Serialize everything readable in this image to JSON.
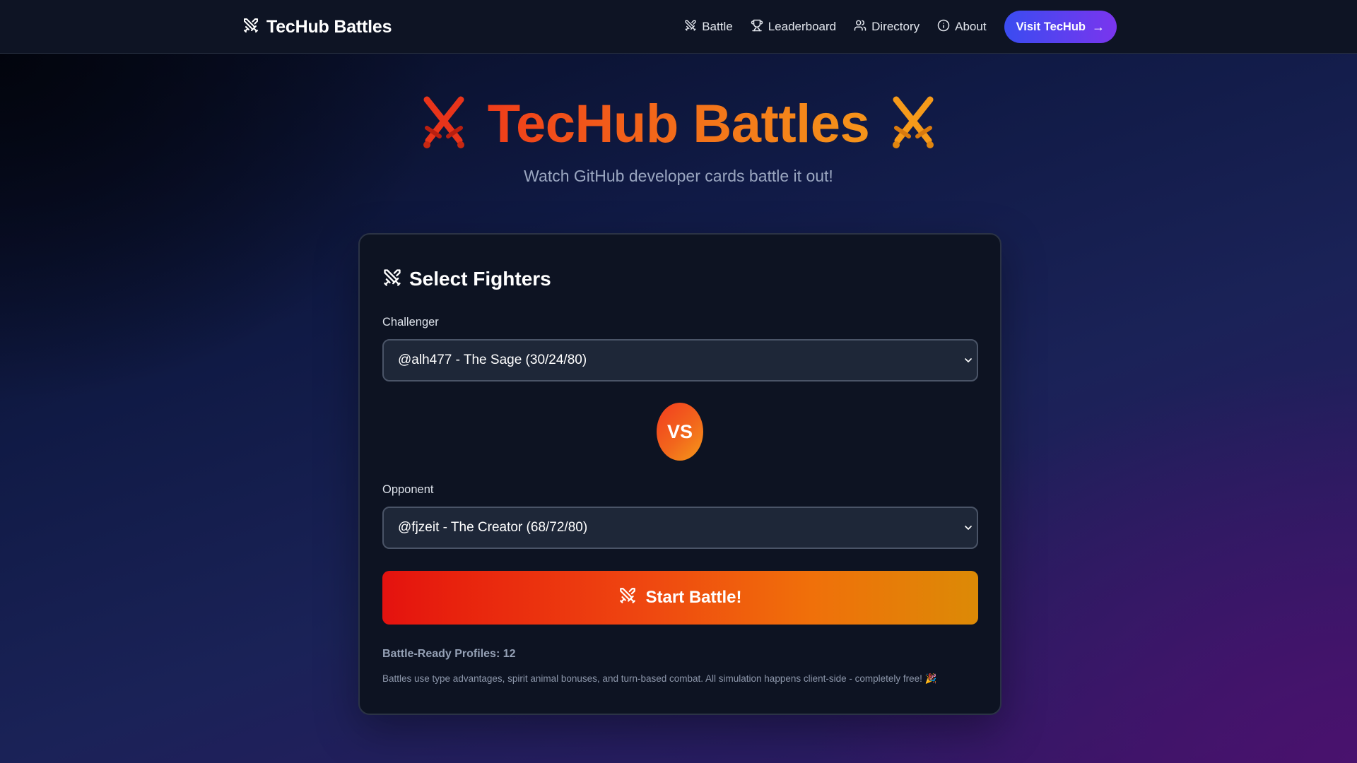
{
  "nav": {
    "brand": "TecHub Battles",
    "links": [
      {
        "label": "Battle",
        "icon": "swords-icon"
      },
      {
        "label": "Leaderboard",
        "icon": "trophy-icon"
      },
      {
        "label": "Directory",
        "icon": "users-icon"
      },
      {
        "label": "About",
        "icon": "info-icon"
      }
    ],
    "cta": {
      "label": "Visit TecHub",
      "arrow": "→"
    }
  },
  "hero": {
    "title": "TecHub Battles",
    "subtitle": "Watch GitHub developer cards battle it out!"
  },
  "card": {
    "title": "Select Fighters",
    "challenger": {
      "label": "Challenger",
      "value": "@alh477 - The Sage (30/24/80)"
    },
    "vs": "VS",
    "opponent": {
      "label": "Opponent",
      "value": "@fjzeit - The Creator (68/72/80)"
    },
    "start_button": "Start Battle!",
    "stats": "Battle-Ready Profiles: 12",
    "footnote": "Battles use type advantages, spirit animal bonuses, and turn-based combat. All simulation happens client-side - completely free! 🎉"
  },
  "colors": {
    "accent_orange": "#f3721a",
    "accent_red": "#e4120f",
    "cta_blue": "#3a4cf0",
    "cta_purple": "#7a35ee",
    "card_bg": "#0d1322"
  }
}
